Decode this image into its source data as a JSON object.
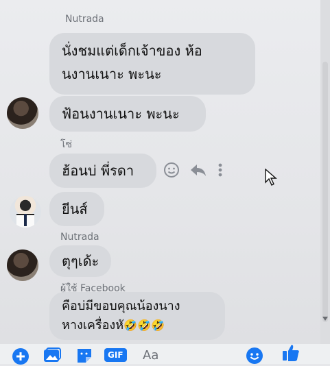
{
  "messages": [
    {
      "sender": "Nutrada",
      "lines": [
        "นั่งชมแต่เด็กเจ้าของ ห้อ",
        "นงานเนาะ พะนะ"
      ]
    },
    {
      "text": "ฟ้อนงานเนาะ พะนะ"
    },
    {
      "sender": "โซ่",
      "text": "ฮ้อนบ่ พี่รดา"
    },
    {
      "text": "ยีนส์"
    },
    {
      "sender": "Nutrada",
      "text": "ตุๆเด้ะ"
    },
    {
      "sender": "ผู้ใช้ Facebook",
      "lines": [
        "คือบ่มีขอบคุณน้องนาง",
        "หางเครื่องหั"
      ],
      "emojis": "🤣🤣🤣"
    }
  ],
  "composer": {
    "placeholder": "Aa",
    "gif_label": "GIF"
  },
  "icons": [
    "smiley-icon",
    "reply-icon",
    "more-icon",
    "plus-icon",
    "image-icon",
    "sticker-icon",
    "gif-icon",
    "emoji-icon",
    "like-icon"
  ],
  "colors": {
    "bubble": "#d7d9dd",
    "accent": "#1877f2"
  }
}
